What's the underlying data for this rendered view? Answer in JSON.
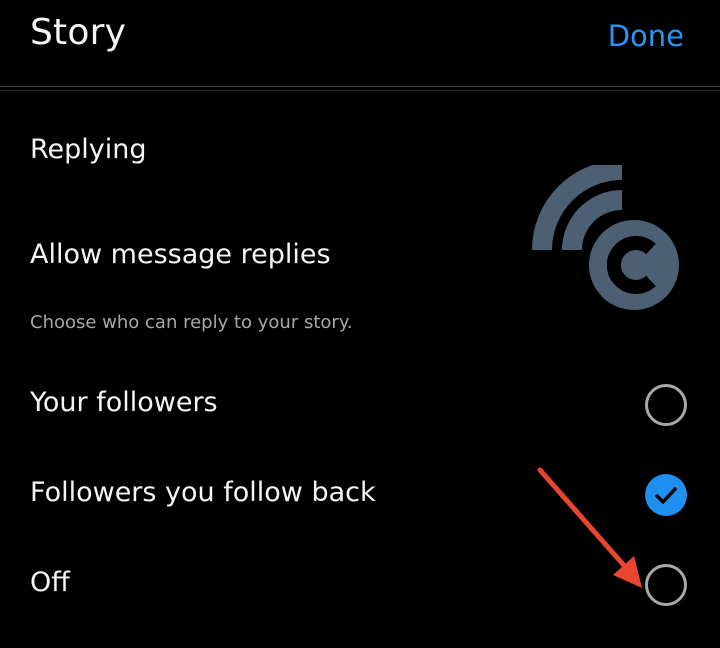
{
  "header": {
    "title": "Story",
    "done_label": "Done"
  },
  "replying": {
    "section_title": "Replying",
    "setting_title": "Allow message replies",
    "helper_text": "Choose who can reply to your story."
  },
  "options": [
    {
      "label": "Your followers",
      "selected": false
    },
    {
      "label": "Followers you follow back",
      "selected": true
    },
    {
      "label": "Off",
      "selected": false
    }
  ],
  "colors": {
    "accent": "#2a95f5",
    "background": "#000000",
    "annotation_arrow": "#e8462e",
    "logo": "#4d5f73"
  },
  "icons": {
    "checked": "check-icon",
    "watermark": "watermark-logo",
    "annotation": "red-arrow"
  }
}
